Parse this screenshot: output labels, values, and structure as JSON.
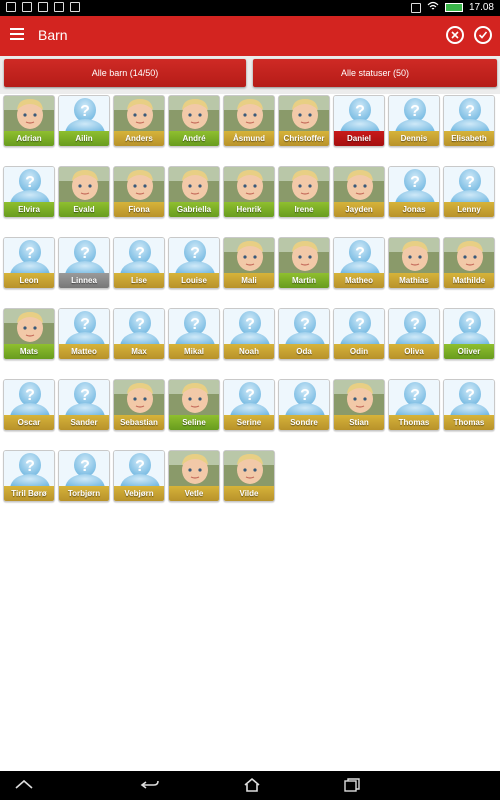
{
  "status_bar": {
    "time": "17.08"
  },
  "app_bar": {
    "title": "Barn",
    "close_icon": "cancel-circle-icon",
    "check_icon": "check-circle-icon"
  },
  "filters": {
    "children_label": "Alle barn (14/50)",
    "status_label": "Alle statuser (50)"
  },
  "colors": {
    "accent": "#d32420",
    "green": "#7aab25",
    "yellow": "#c9a233",
    "red": "#b8141a",
    "gray": "#8a8a8a"
  },
  "children": [
    {
      "name": "Adrian",
      "status": "green",
      "photo": true
    },
    {
      "name": "Ailin",
      "status": "green",
      "photo": false
    },
    {
      "name": "Anders",
      "status": "yellow",
      "photo": true
    },
    {
      "name": "André",
      "status": "green",
      "photo": true
    },
    {
      "name": "Åsmund",
      "status": "yellow",
      "photo": true
    },
    {
      "name": "Christoffer",
      "status": "yellow",
      "photo": true
    },
    {
      "name": "Daniel",
      "status": "red",
      "photo": false
    },
    {
      "name": "Dennis",
      "status": "yellow",
      "photo": false
    },
    {
      "name": "Elisabeth",
      "status": "yellow",
      "photo": false
    },
    {
      "name": "Elvira",
      "status": "green",
      "photo": false
    },
    {
      "name": "Evald",
      "status": "green",
      "photo": true
    },
    {
      "name": "Fiona",
      "status": "yellow",
      "photo": true
    },
    {
      "name": "Gabriella",
      "status": "green",
      "photo": true
    },
    {
      "name": "Henrik",
      "status": "green",
      "photo": true
    },
    {
      "name": "Irene",
      "status": "green",
      "photo": true
    },
    {
      "name": "Jayden",
      "status": "yellow",
      "photo": true
    },
    {
      "name": "Jonas",
      "status": "yellow",
      "photo": false
    },
    {
      "name": "Lenny",
      "status": "yellow",
      "photo": false
    },
    {
      "name": "Leon",
      "status": "yellow",
      "photo": false
    },
    {
      "name": "Linnea",
      "status": "gray",
      "photo": false
    },
    {
      "name": "Lise",
      "status": "yellow",
      "photo": false
    },
    {
      "name": "Louise",
      "status": "yellow",
      "photo": false
    },
    {
      "name": "Mali",
      "status": "yellow",
      "photo": true
    },
    {
      "name": "Martin",
      "status": "green",
      "photo": true
    },
    {
      "name": "Matheo",
      "status": "yellow",
      "photo": false
    },
    {
      "name": "Mathias",
      "status": "yellow",
      "photo": true
    },
    {
      "name": "Mathilde",
      "status": "yellow",
      "photo": true
    },
    {
      "name": "Mats",
      "status": "green",
      "photo": true
    },
    {
      "name": "Matteo",
      "status": "yellow",
      "photo": false
    },
    {
      "name": "Max",
      "status": "yellow",
      "photo": false
    },
    {
      "name": "Mikal",
      "status": "yellow",
      "photo": false
    },
    {
      "name": "Noah",
      "status": "yellow",
      "photo": false
    },
    {
      "name": "Oda",
      "status": "yellow",
      "photo": false
    },
    {
      "name": "Odin",
      "status": "yellow",
      "photo": false
    },
    {
      "name": "Oliva",
      "status": "yellow",
      "photo": false
    },
    {
      "name": "Oliver",
      "status": "green",
      "photo": false
    },
    {
      "name": "Oscar",
      "status": "yellow",
      "photo": false
    },
    {
      "name": "Sander",
      "status": "yellow",
      "photo": false
    },
    {
      "name": "Sebastian",
      "status": "yellow",
      "photo": true
    },
    {
      "name": "Seline",
      "status": "green",
      "photo": true
    },
    {
      "name": "Serine",
      "status": "yellow",
      "photo": false
    },
    {
      "name": "Sondre",
      "status": "yellow",
      "photo": false
    },
    {
      "name": "Stian",
      "status": "yellow",
      "photo": true
    },
    {
      "name": "Thomas",
      "status": "yellow",
      "photo": false
    },
    {
      "name": "Thomas",
      "status": "yellow",
      "photo": false
    },
    {
      "name": "Tiril Børø",
      "status": "yellow",
      "photo": false
    },
    {
      "name": "Torbjørn",
      "status": "yellow",
      "photo": false
    },
    {
      "name": "Vebjørn",
      "status": "yellow",
      "photo": false
    },
    {
      "name": "Vetle",
      "status": "yellow",
      "photo": true
    },
    {
      "name": "Vilde",
      "status": "yellow",
      "photo": true
    }
  ]
}
